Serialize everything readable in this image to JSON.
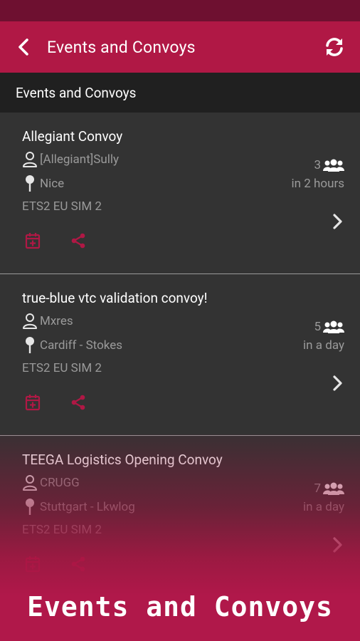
{
  "appbar": {
    "title": "Events and Convoys"
  },
  "section": {
    "title": "Events and Convoys"
  },
  "events": [
    {
      "title": "Allegiant Convoy",
      "user": "[Allegiant]Sully",
      "location": "Nice",
      "server": "ETS2 EU SIM 2",
      "count": "3",
      "when": "in 2 hours"
    },
    {
      "title": "true-blue vtc validation convoy!",
      "user": "Mxres",
      "location": "Cardiff - Stokes",
      "server": "ETS2 EU SIM 2",
      "count": "5",
      "when": "in a day"
    },
    {
      "title": "TEEGA Logistics Opening Convoy",
      "user": "CRUGG",
      "location": "Stuttgart - Lkwlog",
      "server": "ETS2 EU SIM 2",
      "count": "7",
      "when": "in a day"
    }
  ],
  "banner": {
    "text": "Events and Convoys"
  },
  "colors": {
    "primary": "#b01845",
    "statusbar": "#6e1030",
    "card": "#333333",
    "header": "#202020",
    "muted": "#9a9a9a"
  }
}
